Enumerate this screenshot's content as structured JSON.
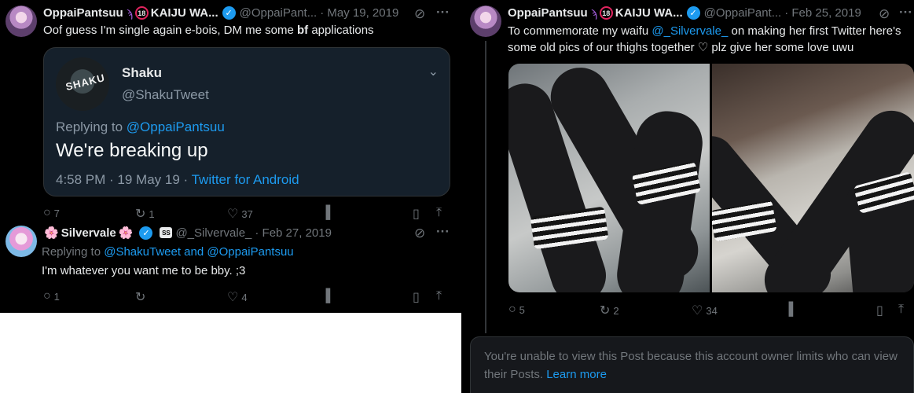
{
  "left": {
    "tweet1": {
      "display_name": "OppaiPantsuu",
      "badge_18": "18",
      "display_name_suffix": "KAIJU WA...",
      "handle": "@OppaiPant...",
      "date": "· May 19, 2019",
      "text_before": "Oof guess I'm single again e-bois, DM me some ",
      "text_bold": "bf",
      "text_after": " applications",
      "quote": {
        "avatar_text": "SHAKU",
        "name": "Shaku",
        "handle": "@ShakuTweet",
        "replying_label": "Replying to ",
        "replying_handle": "@OppaiPantsuu",
        "body": "We're breaking up",
        "time_date": "4:58 PM · 19 May 19 · ",
        "client": "Twitter for Android"
      },
      "replies": "7",
      "retweets": "1",
      "likes": "37"
    },
    "tweet2": {
      "flower": "🌸",
      "display_name": "Silvervale",
      "affiliate": "SS",
      "handle": "@_Silvervale_",
      "date": "· Feb 27, 2019",
      "replying_label": "Replying to ",
      "replying_handles": "@ShakuTweet and @OppaiPantsuu",
      "text": "I'm whatever you want me to be bby. ;3",
      "replies": "1",
      "retweets": "",
      "likes": "4"
    }
  },
  "right": {
    "tweet": {
      "display_name": "OppaiPantsuu",
      "badge_18": "18",
      "display_name_suffix": "KAIJU WA...",
      "handle": "@OppaiPant...",
      "date": "· Feb 25, 2019",
      "text_before": "To commemorate my waifu ",
      "mention": "@_Silvervale_",
      "text_after": " on making her first Twitter here's some old pics of our thighs together ♡ plz give her some love uwu",
      "replies": "5",
      "retweets": "2",
      "likes": "34"
    },
    "notice": {
      "text": "You're unable to view this Post because this account owner limits who can view their Posts. ",
      "link": "Learn more"
    }
  },
  "icons": {
    "reply": "○",
    "retweet": "↻",
    "like": "♡",
    "views": "▐",
    "bookmark": "▯",
    "share": "⤒",
    "grok": "⊘",
    "more": "···",
    "chevron": "⌄",
    "verified": "✓",
    "horns": "ϡ"
  },
  "colors": {
    "accent": "#1d9bf0",
    "background": "#000000",
    "quote_bg": "#15202b",
    "muted": "#71767b"
  }
}
